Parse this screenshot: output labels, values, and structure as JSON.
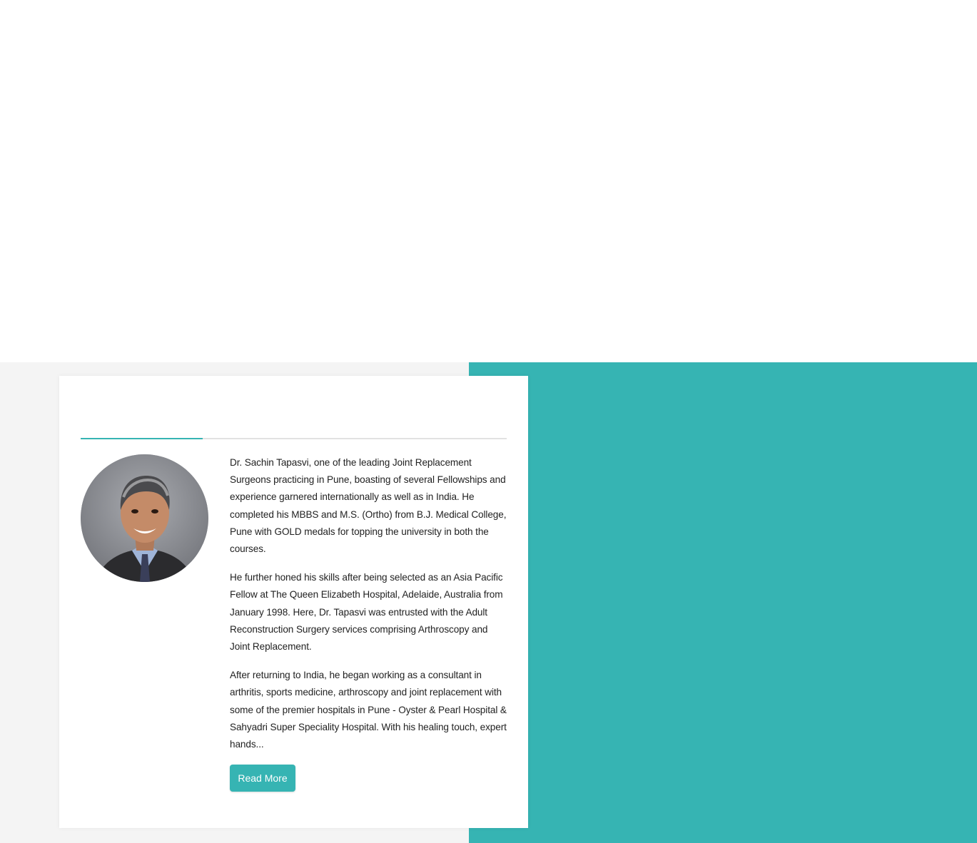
{
  "colors": {
    "accent": "#36b4b3",
    "section_bg": "#f4f4f4",
    "card_bg": "#ffffff",
    "text": "#222222",
    "divider": "#e2e2e2"
  },
  "doctor": {
    "photo_icon": "doctor-portrait",
    "bio_paragraphs": [
      "Dr. Sachin Tapasvi, one of the leading Joint Replacement Surgeons practicing in Pune, boasting of several Fellowships and experience garnered internationally as well as in India. He completed his MBBS and M.S. (Ortho) from B.J. Medical College, Pune with GOLD medals for topping the university in both the courses.",
      "He further honed his skills after being selected as an Asia Pacific Fellow at The Queen Elizabeth Hospital, Adelaide, Australia from January 1998. Here, Dr. Tapasvi was entrusted with the Adult Reconstruction Surgery services comprising Arthroscopy and Joint Replacement.",
      "After returning to India, he began working as a consultant in arthritis, sports medicine, arthroscopy and joint replacement with some of the premier hospitals in Pune - Oyster & Pearl Hospital & Sahyadri Super Speciality Hospital. With his healing touch, expert hands..."
    ],
    "read_more_label": "Read More"
  }
}
